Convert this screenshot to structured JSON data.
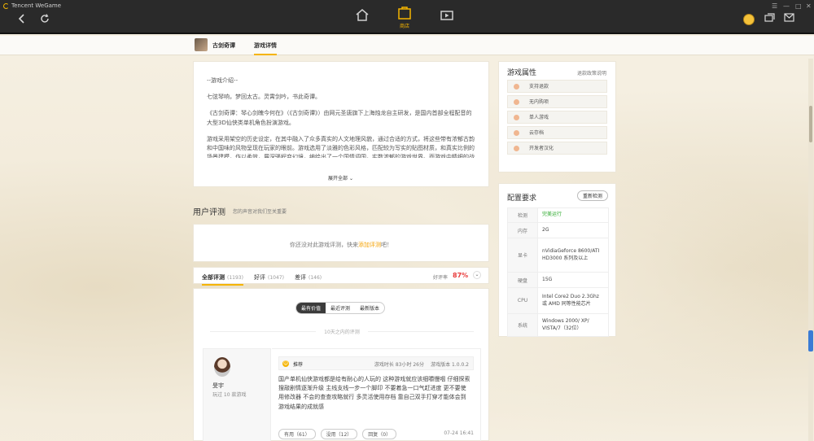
{
  "app": {
    "title": "Tencent WeGame"
  },
  "topnav": {
    "store_label": "商店"
  },
  "subnav": {
    "game_name": "古剑奇谭",
    "tab_details": "游戏详情"
  },
  "intro": {
    "paragraphs": [
      "--游戏介绍--",
      "七弦琴响，梦回太古。灵霄剑吟，书此奇谭。",
      "《古剑奇谭：琴心剑魄今何在》（《古剑奇谭》）由网元圣唐旗下上海烛龙自主研发，是国内首部全程配音的大型3D仙侠类单机角色扮演游戏。",
      "游戏采用架空的历史设定，在其中融入了众多真实的人文地理风貌，通过合适的方式，将这些带有浓郁古韵和中国味的风物呈现在玩家的眼前。游戏选用了淡雅的色彩风格，匹配较为写实的贴图材质，和真实比例的场景建模，作以柔效，展深骚程变幻境，编绘出了一个国情调国，实数浓郁的游戏世界。而游戏中精细的战斗系统，更"
    ],
    "expand_label": "展开全部"
  },
  "reviews_section": {
    "title": "用户评测",
    "subtitle": "您的声音对我们至关重要"
  },
  "empty_review": {
    "text": "你还没对此游戏评测，快来",
    "link": "添加评测",
    "suffix": "吧！"
  },
  "filter": {
    "tabs": [
      {
        "label": "全部评测",
        "count": "(1193)"
      },
      {
        "label": "好评",
        "count": "(1047)"
      },
      {
        "label": "差评",
        "count": "(146)"
      }
    ],
    "rate_label": "好评率",
    "rate_value": "87%"
  },
  "sort": {
    "options": [
      "最有价值",
      "最近评测",
      "最新版本"
    ]
  },
  "time_header": "10天之内的评测",
  "review": {
    "user_name": "旻宇",
    "user_meta": "玩过 10 款游戏",
    "recommend": "推荐",
    "playtime": "游戏时长 83小时 26分",
    "version": "游戏版本 1.0.0.2",
    "text": "国产单机仙侠游戏都是给有耐心的人玩的 这种游戏就应该细嚼慢咽 仔细探索搜敲剧情逐渐升级 主线支线一步一个脚印 不要着急一口气赶进度 更不要使用修改器 不会的查查攻略就行 多灵活使用存档 靠自己双手打穿才能体会到游戏结果的成就感",
    "useful": "有用（61）",
    "useless": "没用（12）",
    "reply": "回复（0）",
    "date": "07-24 16:41"
  },
  "attributes": {
    "title": "游戏属性",
    "link": "退款政策说明",
    "items": [
      "支持退款",
      "无内购项",
      "单人游戏",
      "云存档",
      "开发者汉化"
    ]
  },
  "requirements": {
    "title": "配置要求",
    "retest": "重新检测",
    "rows": [
      {
        "k": "检测",
        "v": "完美运行"
      },
      {
        "k": "内存",
        "v": "2G"
      },
      {
        "k": "显卡",
        "v": "nVidiaGeforce 8600/ATI HD3000 系列及以上"
      },
      {
        "k": "硬盘",
        "v": "15G"
      },
      {
        "k": "CPU",
        "v": "Intel Core2 Duo 2.3Ghz 或 AMD 同等性能芯片"
      },
      {
        "k": "系统",
        "v": "Windows 2000/ XP/ VISTA/7（32位）"
      }
    ]
  },
  "colors": {
    "accent": "#f5b400",
    "positive_rate": "#e83b3b",
    "ok": "#29a829"
  }
}
